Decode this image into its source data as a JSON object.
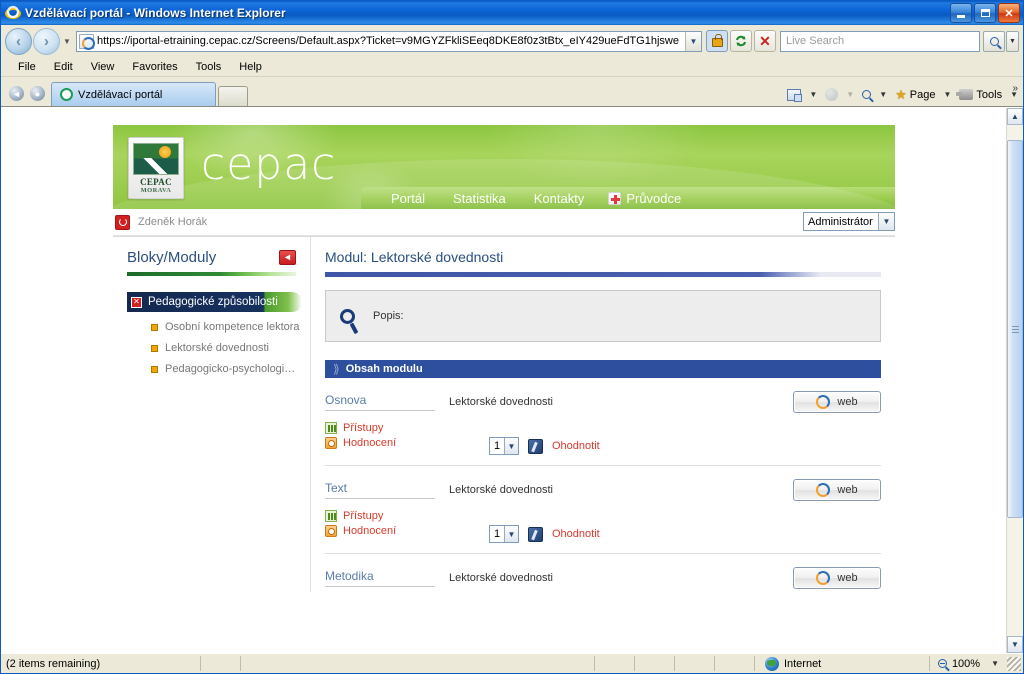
{
  "window": {
    "title": "Vzdělávací portál - Windows Internet Explorer",
    "minimize_label": "Minimize",
    "maximize_label": "Maximize",
    "close_label": "Close"
  },
  "browser": {
    "back_label": "Back",
    "forward_label": "Forward",
    "recent_pages_label": "Recent Pages",
    "url": "https://iportal-etraining.cepac.cz/Screens/Default.aspx?Ticket=v9MGYZFkliSEeq8DKE8f0z3tBtx_eIY429ueFdTG1hjswe",
    "url_dropdown_label": "▼",
    "security_icon": "lock-icon",
    "refresh_label": "↻",
    "stop_label": "✕",
    "search_placeholder": "Live Search",
    "search_value": "",
    "menu": [
      "File",
      "Edit",
      "View",
      "Favorites",
      "Tools",
      "Help"
    ],
    "tabs": [
      {
        "label": "Vzdělávací portál",
        "icon": "page-loading-icon",
        "active": true
      }
    ],
    "new_tab_label": "",
    "command_bar": [
      {
        "name": "read-mail",
        "label": "",
        "icon": "mail-icon",
        "has_dropdown": true,
        "dropdown_dim": false
      },
      {
        "name": "print",
        "label": "",
        "icon": "print-globe-icon",
        "has_dropdown": true,
        "dropdown_dim": true
      },
      {
        "name": "page-find",
        "label": "",
        "icon": "magnifier-icon",
        "has_dropdown": true,
        "dropdown_dim": false
      },
      {
        "name": "page",
        "label": "Page",
        "icon": "star-icon",
        "has_dropdown": true,
        "dropdown_dim": false
      },
      {
        "name": "tools",
        "label": "Tools",
        "icon": "tools-icon",
        "has_dropdown": true,
        "dropdown_dim": false
      }
    ],
    "overflow_label": "»"
  },
  "site": {
    "brand": "cepac",
    "logo": {
      "line1": "CEPAC",
      "line2": "MORAVA"
    },
    "nav": [
      {
        "label": "Portál",
        "icon": null
      },
      {
        "label": "Statistika",
        "icon": null
      },
      {
        "label": "Kontakty",
        "icon": null
      },
      {
        "label": "Průvodce",
        "icon": "plus-icon"
      }
    ],
    "user": {
      "name": "Zdeněk Horák",
      "logout_icon": "power-icon",
      "role_selected": "Administrátor",
      "role_dropdown_label": "▼"
    }
  },
  "sidebar": {
    "title": "Bloky/Moduly",
    "collapse_label": "◄",
    "active_item": {
      "label": "Pedagogické způsobilosti",
      "close_label": "✕"
    },
    "items": [
      {
        "label": "Osobní kompetence lektora"
      },
      {
        "label": "Lektorské dovednosti"
      },
      {
        "label": "Pedagogicko-psychologi…"
      }
    ]
  },
  "content": {
    "module_title": "Modul: Lektorské dovednosti",
    "progress_percent": 89,
    "description_label": "Popis:",
    "description_value": "",
    "search_icon": "magnifier-icon",
    "section_title": "Obsah modulu",
    "rows": [
      {
        "name": "Osnova",
        "description": "Lektorské dovednosti",
        "web_button": "web",
        "access_link": "Přístupy",
        "rating_link": "Hodnocení",
        "rating_value": "1",
        "rating_dropdown_label": "▼",
        "rate_action": "Ohodnotit",
        "has_footer": true
      },
      {
        "name": "Text",
        "description": "Lektorské dovednosti",
        "web_button": "web",
        "access_link": "Přístupy",
        "rating_link": "Hodnocení",
        "rating_value": "1",
        "rating_dropdown_label": "▼",
        "rate_action": "Ohodnotit",
        "has_footer": true
      },
      {
        "name": "Metodika",
        "description": "Lektorské dovednosti",
        "web_button": "web",
        "access_link": "",
        "rating_link": "",
        "rating_value": "",
        "rating_dropdown_label": "",
        "rate_action": "",
        "has_footer": false
      }
    ]
  },
  "statusbar": {
    "message": "(2 items remaining)",
    "zone": "Internet",
    "zone_icon": "globe-icon",
    "zoom": "100%",
    "zoom_dropdown_label": "▼"
  },
  "scrollbar": {
    "up_label": "▲",
    "down_label": "▼",
    "thumb_top_percent": 3,
    "thumb_height_percent": 74
  },
  "colors": {
    "title_bar": "#0a5bc4",
    "brand_green": "#8cc63f",
    "section_blue": "#2d4f9e",
    "link_blue": "#5a7ca8",
    "link_red": "#d93a2b",
    "sidebar_navy": "#13294f"
  }
}
